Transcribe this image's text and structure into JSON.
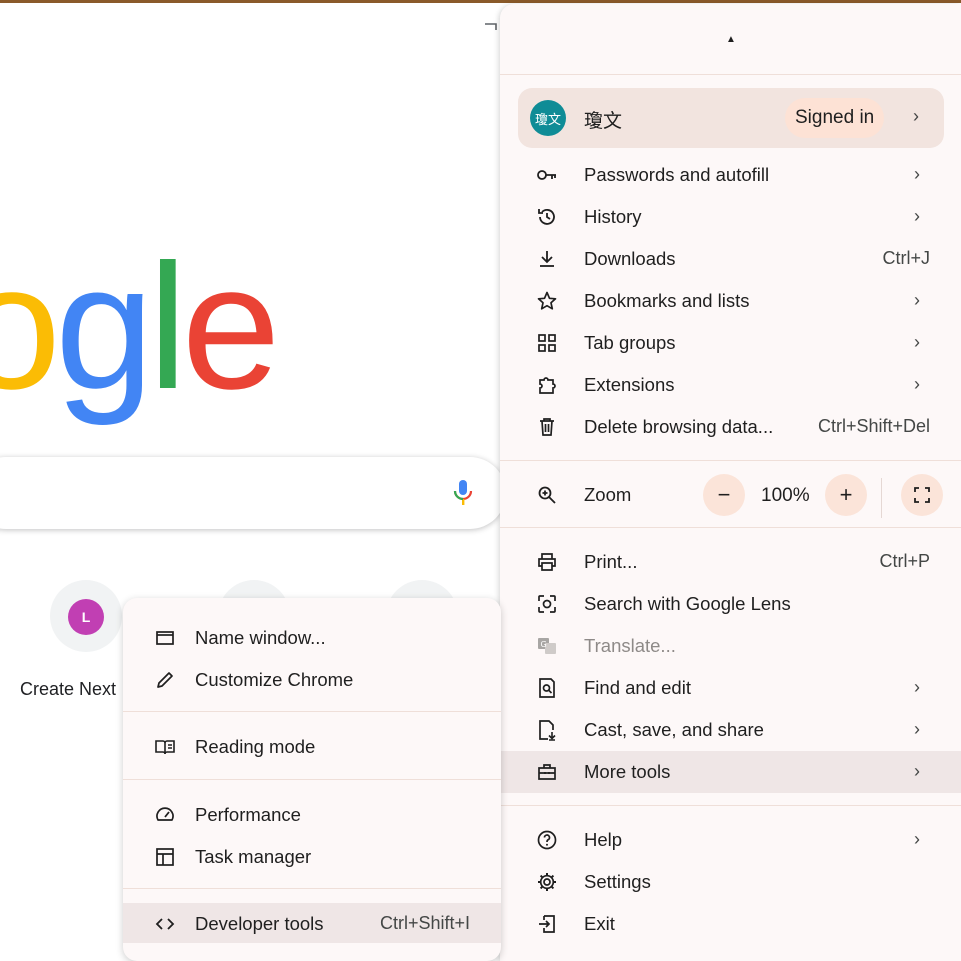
{
  "page": {
    "logo_letters": [
      "o",
      "g",
      "l",
      "e"
    ],
    "shortcut": {
      "avatar_letter": "L",
      "label": "Create Next"
    }
  },
  "menu": {
    "profile": {
      "avatar_text": "瓊文",
      "name": "瓊文",
      "badge": "Signed in"
    },
    "items": [
      {
        "label": "Passwords and autofill",
        "icon": "key-icon",
        "shortcut": "",
        "arrow": true
      },
      {
        "label": "History",
        "icon": "history-icon",
        "shortcut": "",
        "arrow": true
      },
      {
        "label": "Downloads",
        "icon": "download-icon",
        "shortcut": "Ctrl+J",
        "arrow": false
      },
      {
        "label": "Bookmarks and lists",
        "icon": "star-icon",
        "shortcut": "",
        "arrow": true
      },
      {
        "label": "Tab groups",
        "icon": "grid-icon",
        "shortcut": "",
        "arrow": true
      },
      {
        "label": "Extensions",
        "icon": "puzzle-icon",
        "shortcut": "",
        "arrow": true
      },
      {
        "label": "Delete browsing data...",
        "icon": "trash-icon",
        "shortcut": "Ctrl+Shift+Del",
        "arrow": false
      }
    ],
    "zoom": {
      "label": "Zoom",
      "minus": "−",
      "value": "100%",
      "plus": "+"
    },
    "items2": [
      {
        "label": "Print...",
        "icon": "print-icon",
        "shortcut": "Ctrl+P",
        "arrow": false
      },
      {
        "label": "Search with Google Lens",
        "icon": "lens-icon",
        "shortcut": "",
        "arrow": false
      },
      {
        "label": "Translate...",
        "icon": "translate-icon",
        "shortcut": "",
        "arrow": false
      },
      {
        "label": "Find and edit",
        "icon": "find-icon",
        "shortcut": "",
        "arrow": true
      },
      {
        "label": "Cast, save, and share",
        "icon": "cast-save-icon",
        "shortcut": "",
        "arrow": true
      },
      {
        "label": "More tools",
        "icon": "toolbox-icon",
        "shortcut": "",
        "arrow": true
      }
    ],
    "items3": [
      {
        "label": "Help",
        "icon": "help-icon",
        "arrow": true
      },
      {
        "label": "Settings",
        "icon": "gear-icon",
        "arrow": false
      },
      {
        "label": "Exit",
        "icon": "exit-icon",
        "arrow": false
      }
    ],
    "arrow_glyph": "›"
  },
  "submenu": {
    "items": [
      {
        "label": "Name window...",
        "icon": "window-icon"
      },
      {
        "label": "Customize Chrome",
        "icon": "pencil-icon"
      },
      {
        "label": "Reading mode",
        "icon": "book-icon"
      },
      {
        "label": "Performance",
        "icon": "speedometer-icon"
      },
      {
        "label": "Task manager",
        "icon": "task-manager-icon"
      },
      {
        "label": "Developer tools",
        "icon": "code-icon",
        "shortcut": "Ctrl+Shift+I"
      }
    ]
  }
}
